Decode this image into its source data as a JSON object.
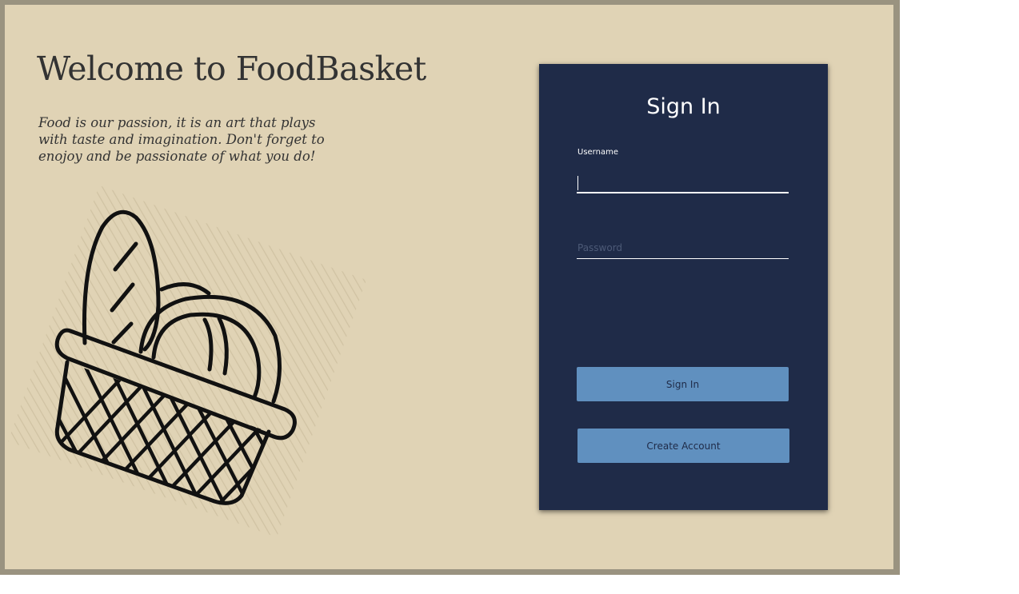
{
  "welcome": {
    "title": "Welcome to FoodBasket",
    "tagline": "Food is our passion, it is an art that plays with taste and imagination. Don't forget to enojoy and be passionate of what you do!"
  },
  "illustration": {
    "icon": "bread-basket-icon"
  },
  "signin": {
    "title": "Sign In",
    "username_label": "Username",
    "username_value": "",
    "password_placeholder": "Password",
    "signin_button_label": "Sign In",
    "create_account_label": "Create Account"
  },
  "colors": {
    "background": "#e0d3b5",
    "frame": "#9a9380",
    "card": "#1f2b48",
    "button": "#6090bf",
    "text_dark": "#333333"
  }
}
